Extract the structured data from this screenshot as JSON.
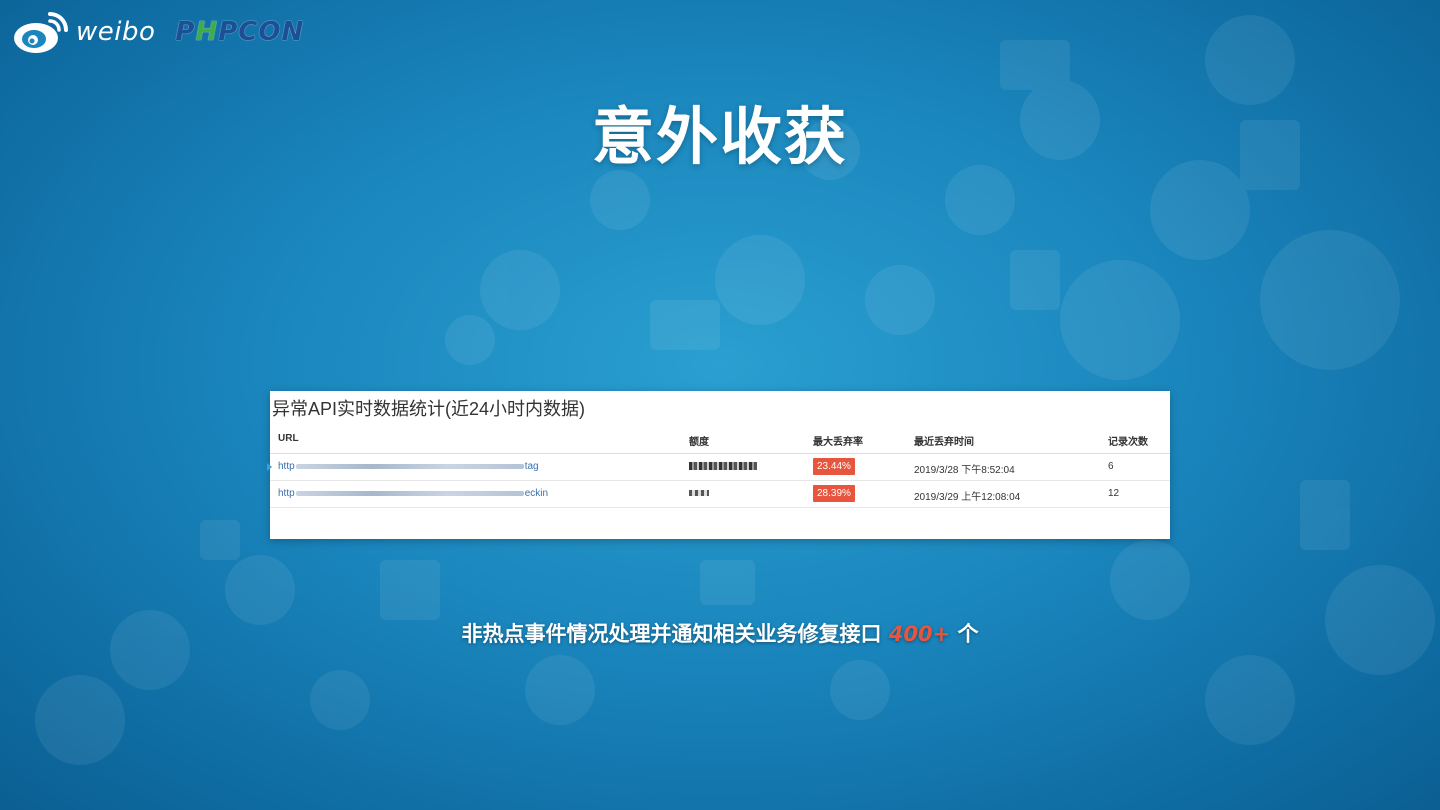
{
  "header": {
    "weibo_logo_text": "weibo",
    "phpcon_logo": {
      "pre": "P",
      "mid": "H",
      "post": "PCON"
    }
  },
  "slide": {
    "title": "意外收获"
  },
  "panel": {
    "title": "异常API实时数据统计(近24小时内数据)",
    "columns": {
      "url": "URL",
      "quota": "额度",
      "max_drop_rate": "最大丢弃率",
      "last_drop_time": "最近丢弃时间",
      "record_count": "记录次数"
    },
    "rows": [
      {
        "url_start": "http",
        "url_end": "tag",
        "max_drop_rate": "23.44%",
        "last_drop_time": "2019/3/28 下午8:52:04",
        "record_count": "6"
      },
      {
        "url_start": "http",
        "url_end": "eckin",
        "max_drop_rate": "28.39%",
        "last_drop_time": "2019/3/29 上午12:08:04",
        "record_count": "12"
      }
    ]
  },
  "footer": {
    "text_main": "非热点事件情况处理并通知相关业务修复接口",
    "highlight": "400+",
    "suffix": "个"
  },
  "colors": {
    "accent_red": "#e8553e",
    "link_blue": "#3a6fb0",
    "bg_blue": "#1a86bd"
  }
}
